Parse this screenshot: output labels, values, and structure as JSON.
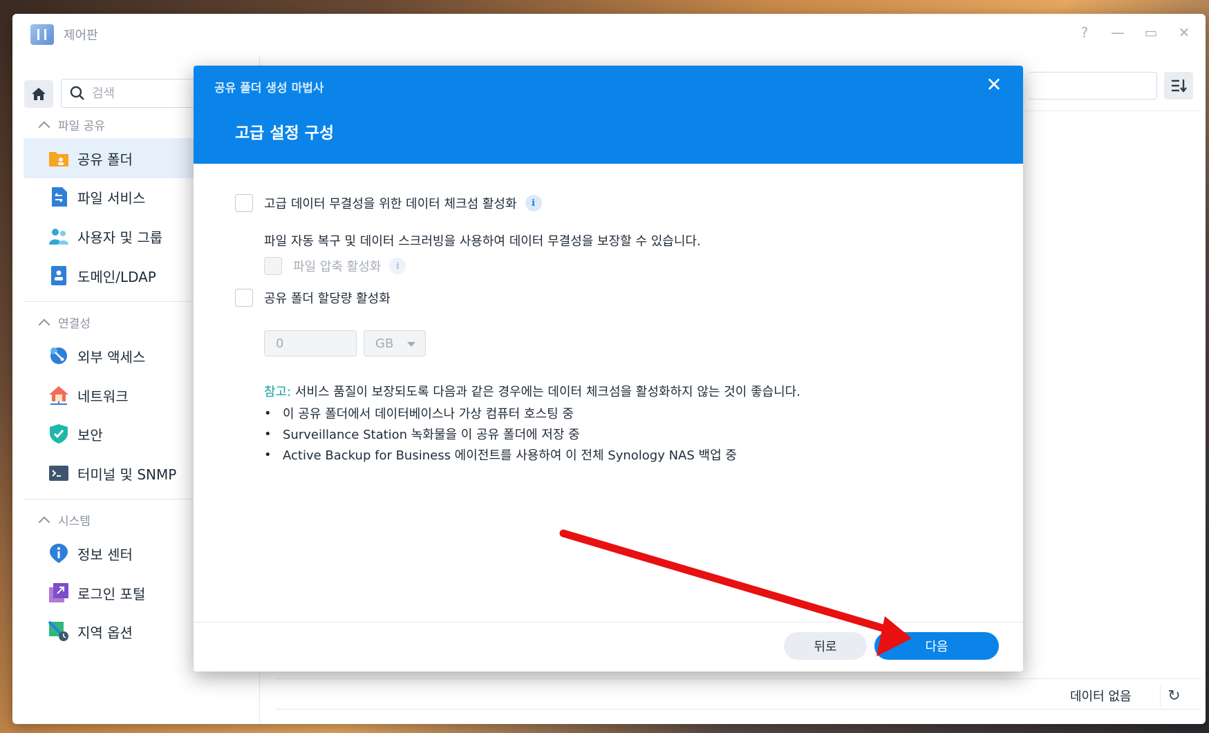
{
  "window": {
    "title": "제어판",
    "help": "?",
    "minimize": "—",
    "maximize": "▭",
    "close": "✕"
  },
  "sidebar": {
    "search_placeholder": "검색",
    "sections": [
      {
        "header": "파일 공유",
        "items": [
          {
            "label": "공유 폴더",
            "icon": "shared-folder-icon",
            "active": true
          },
          {
            "label": "파일 서비스",
            "icon": "file-services-icon"
          },
          {
            "label": "사용자 및 그룹",
            "icon": "users-groups-icon"
          },
          {
            "label": "도메인/LDAP",
            "icon": "domain-ldap-icon"
          }
        ]
      },
      {
        "header": "연결성",
        "items": [
          {
            "label": "외부 액세스",
            "icon": "external-access-icon"
          },
          {
            "label": "네트워크",
            "icon": "network-icon"
          },
          {
            "label": "보안",
            "icon": "security-shield-icon"
          },
          {
            "label": "터미널 및 SNMP",
            "icon": "terminal-icon"
          }
        ]
      },
      {
        "header": "시스템",
        "items": [
          {
            "label": "정보 센터",
            "icon": "info-center-icon"
          },
          {
            "label": "로그인 포털",
            "icon": "login-portal-icon"
          },
          {
            "label": "지역 옵션",
            "icon": "regional-options-icon"
          }
        ]
      }
    ]
  },
  "main": {
    "no_data": "데이터 없음"
  },
  "dialog": {
    "wizard_title": "공유 폴더 생성 마법사",
    "close": "✕",
    "step_title": "고급 설정 구성",
    "options": {
      "checksum_label": "고급 데이터 무결성을 위한 데이터 체크섬 활성화",
      "checksum_desc": "파일 자동 복구 및 데이터 스크러빙을 사용하여 데이터 무결성을 보장할 수 있습니다.",
      "compression_label": "파일 압축 활성화",
      "quota_label": "공유 폴더 할당량 활성화",
      "quota_value": "0",
      "quota_unit": "GB"
    },
    "note": {
      "label": "참고:",
      "text": " 서비스 품질이 보장되도록 다음과 같은 경우에는 데이터 체크섬을 활성화하지 않는 것이 좋습니다.",
      "bullets": [
        "이 공유 폴더에서 데이터베이스나 가상 컴퓨터 호스팅 중",
        "Surveillance Station 녹화물을 이 공유 폴더에 저장 중",
        "Active Backup for Business 에이전트를 사용하여 이 전체 Synology NAS 백업 중"
      ]
    },
    "buttons": {
      "back": "뒤로",
      "next": "다음"
    }
  },
  "annotation": {
    "arrow_color": "#e81010"
  },
  "colors": {
    "accent": "#0a84e8",
    "note_label": "#0aa3a3"
  }
}
